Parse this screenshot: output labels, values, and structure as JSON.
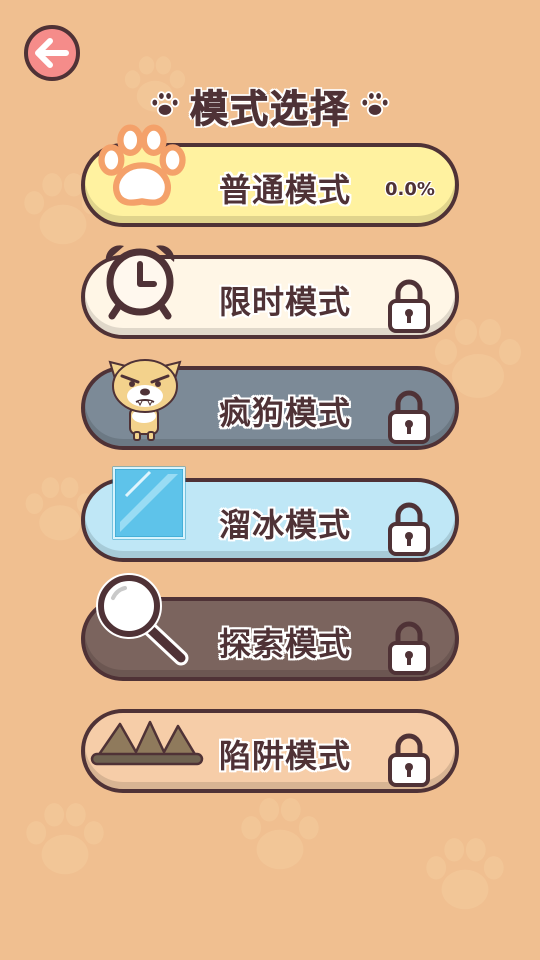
{
  "header": {
    "back_icon": "back-arrow-icon",
    "title": "模式选择",
    "title_icon": "paw-icon"
  },
  "modes": [
    {
      "label": "普通模式",
      "progress": "0.0%",
      "locked": false,
      "icon": "paw-icon",
      "color": "#fff2a0"
    },
    {
      "label": "限时模式",
      "locked": true,
      "icon": "alarm-clock-icon",
      "color": "#fff6e6"
    },
    {
      "label": "疯狗模式",
      "locked": true,
      "icon": "angry-dog-icon",
      "color": "#7c8a97"
    },
    {
      "label": "溜冰模式",
      "locked": true,
      "icon": "ice-block-icon",
      "color": "#bfe7f6"
    },
    {
      "label": "探索模式",
      "locked": true,
      "icon": "magnifier-icon",
      "color": "#7b645e"
    },
    {
      "label": "陷阱模式",
      "locked": true,
      "icon": "spike-trap-icon",
      "color": "#f6cda8"
    }
  ],
  "colors": {
    "background": "#f0bf90",
    "outline": "#4f3236",
    "back_button": "#f58c8a"
  }
}
